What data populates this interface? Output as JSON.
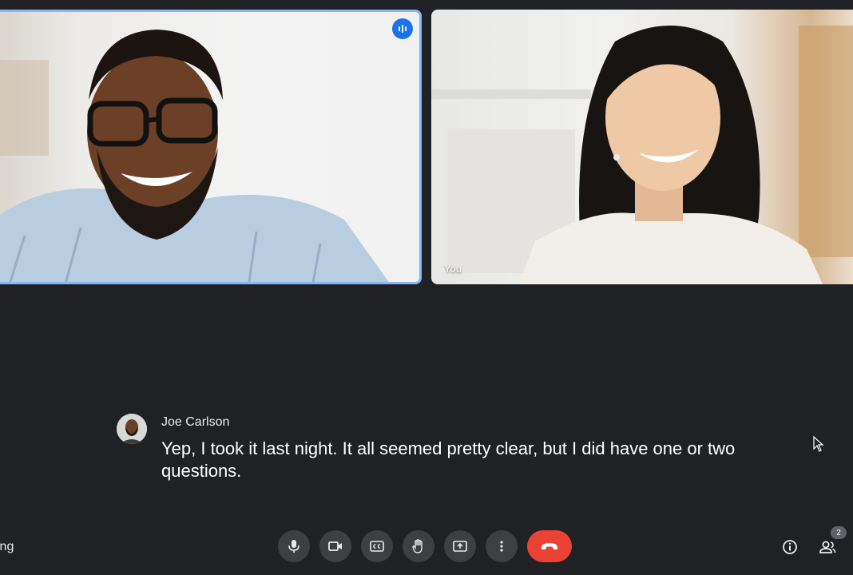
{
  "tiles": [
    {
      "name": "",
      "speaking": true
    },
    {
      "name": "You",
      "speaking": false
    }
  ],
  "caption": {
    "speaker": "Joe Carlson",
    "text": "Yep, I took it last night. It all seemed pretty clear, but I did have one or two questions."
  },
  "bottom_left_text": "ing",
  "controls": [
    {
      "icon": "microphone-icon"
    },
    {
      "icon": "camera-icon"
    },
    {
      "icon": "captions-icon"
    },
    {
      "icon": "raise-hand-icon"
    },
    {
      "icon": "present-screen-icon"
    },
    {
      "icon": "more-options-icon"
    },
    {
      "icon": "end-call-icon"
    }
  ],
  "right_controls": [
    {
      "icon": "info-icon"
    },
    {
      "icon": "people-icon",
      "count": "2"
    }
  ],
  "colors": {
    "background": "#202124",
    "control_bg": "#3c4043",
    "end_call": "#ea4335",
    "active_speaker_border": "#8ab4f8",
    "speaking_badge": "#1a73e8"
  }
}
